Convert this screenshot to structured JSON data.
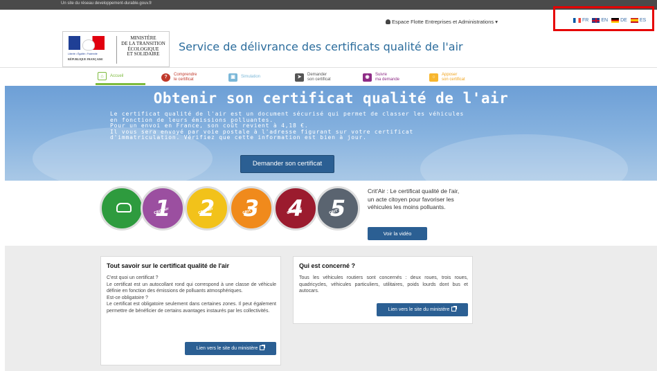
{
  "topbar": {
    "text": "Un site du réseau developpement-durable.gouv.fr"
  },
  "header": {
    "espace_label": "Espace Flotte Entreprises et Administrations ▾",
    "languages": [
      {
        "code": "FR",
        "label": "FR"
      },
      {
        "code": "EN",
        "label": "EN"
      },
      {
        "code": "DE",
        "label": "DE"
      },
      {
        "code": "ES",
        "label": "ES"
      }
    ],
    "logo": {
      "devise": "Liberté • Égalité • Fraternité",
      "republique": "RÉPUBLIQUE FRANÇAISE",
      "ministere_lines": [
        "MINISTÈRE",
        "DE LA TRANSITION",
        "ÉCOLOGIQUE",
        "ET SOLIDAIRE"
      ]
    },
    "site_title": "Service de délivrance des certificats qualité de l'air"
  },
  "nav": [
    {
      "label_line1": "Accueil",
      "label_line2": "",
      "icon": "home-icon"
    },
    {
      "label_line1": "Comprendre",
      "label_line2": "le certificat",
      "icon": "question-icon"
    },
    {
      "label_line1": "Simulation",
      "label_line2": "",
      "icon": "car-icon"
    },
    {
      "label_line1": "Demander",
      "label_line2": "son certificat",
      "icon": "send-icon"
    },
    {
      "label_line1": "Suivre",
      "label_line2": "ma demande",
      "icon": "search-icon"
    },
    {
      "label_line1": "Apposer",
      "label_line2": "son certificat",
      "icon": "sticker-icon"
    }
  ],
  "hero": {
    "title": "Obtenir son certificat qualité de l'air",
    "paragraphs": [
      "Le certificat qualité de l'air est un document sécurisé qui permet de classer les véhicules en fonction de leurs émissions polluantes.",
      "Pour un envoi en France, son coût revient à 4,18 €.",
      "Il vous sera envoyé par voie postale à l'adresse figurant sur votre certificat d'immatriculation. Vérifiez que cette information est bien à jour."
    ],
    "button_label": "Demander son certificat"
  },
  "stickers": [
    {
      "label": "",
      "color": "#2e9b3e"
    },
    {
      "label": "1",
      "color": "#9b4fa0"
    },
    {
      "label": "2",
      "color": "#f2c21a"
    },
    {
      "label": "3",
      "color": "#f08a1c"
    },
    {
      "label": "4",
      "color": "#9b1b2e"
    },
    {
      "label": "5",
      "color": "#5a6470"
    }
  ],
  "critair": {
    "crit_label": "CRIT'Air",
    "description": "Crit'Air : Le certificat qualité de l'air, un acte citoyen pour favoriser les véhicules les moins polluants.",
    "video_button": "Voir la vidéo"
  },
  "cards": {
    "left": {
      "title": "Tout savoir sur le certificat qualité de l'air",
      "lines": [
        "C'est quoi un certificat ?",
        "Le certificat est un autocollant rond qui correspond à une classe de véhicule définie en fonction des émissions de polluants atmosphériques.",
        "Est-ce obligatoire ?",
        "Le certificat est obligatoire seulement dans certaines zones. Il peut également permettre de bénéficier de certains avantages instaurés par les collectivités."
      ],
      "button": "Lien vers le site du ministère"
    },
    "right": {
      "title": "Qui est concerné ?",
      "body": "Tous les véhicules routiers sont concernés : deux roues, trois roues, quadricycles, véhicules particuliers, utilitaires, poids lourds dont bus et autocars.",
      "button": "Lien vers le site du ministère"
    }
  }
}
